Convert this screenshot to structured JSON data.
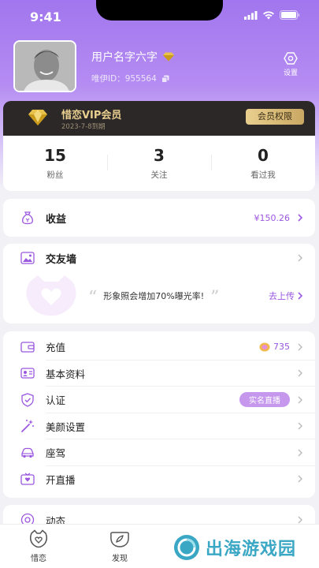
{
  "status": {
    "time": "9:41"
  },
  "profile": {
    "username": "用户名字六字",
    "id_label": "唯伊ID：",
    "id_value": "955564",
    "settings_label": "设置"
  },
  "vip": {
    "title": "惜恋VIP会员",
    "expiry": "2023-7-8到期",
    "button": "会员权限"
  },
  "stats": [
    {
      "value": "15",
      "label": "粉丝"
    },
    {
      "value": "3",
      "label": "关注"
    },
    {
      "value": "0",
      "label": "看过我"
    }
  ],
  "income": {
    "label": "收益",
    "value": "¥150.26"
  },
  "wall": {
    "label": "交友墙",
    "tip": "形象照会增加70%曝光率!",
    "upload": "去上传"
  },
  "menu": [
    {
      "label": "充值",
      "value": "735"
    },
    {
      "label": "基本资料"
    },
    {
      "label": "认证",
      "badge": "实名直播"
    },
    {
      "label": "美颜设置"
    },
    {
      "label": "座驾"
    },
    {
      "label": "开直播"
    }
  ],
  "partial_row": {
    "label": "动态"
  },
  "tabs": [
    {
      "label": "惜恋"
    },
    {
      "label": "发现"
    }
  ],
  "watermark": "出海游戏园",
  "colors": {
    "accent": "#9b57e0",
    "gold": "#e9cf8f",
    "vip_bg": "#2c2828"
  }
}
